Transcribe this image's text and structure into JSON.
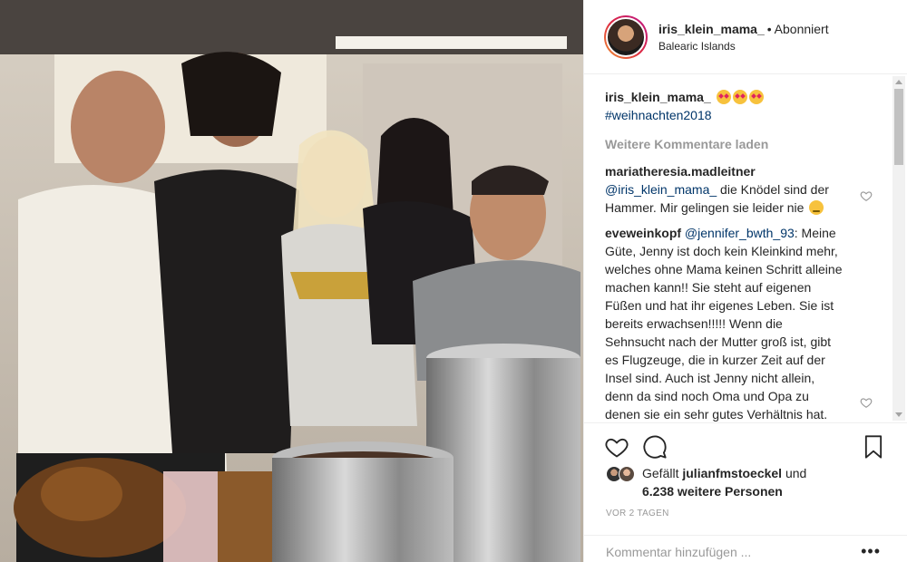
{
  "post": {
    "photo_alt": "Group photo in a kitchen with roasted chicken and cooking pots"
  },
  "header": {
    "username": "iris_klein_mama_",
    "separator": "•",
    "follow_status": "Abonniert",
    "location": "Balearic Islands"
  },
  "caption": {
    "username": "iris_klein_mama_",
    "hashtag": "#weihnachten2018"
  },
  "load_more_label": "Weitere Kommentare laden",
  "comments": [
    {
      "username": "mariatheresia.madleitner",
      "mention": "@iris_klein_mama_",
      "text": " die Knödel sind der Hammer. Mir gelingen sie leider nie "
    },
    {
      "username": "eveweinkopf",
      "mention": "@jennifer_bwth_93",
      "text": ": Meine Güte, Jenny ist doch kein Kleinkind mehr, welches ohne Mama keinen Schritt alleine machen kann!! Sie steht auf eigenen Füßen und hat ihr eigenes Leben. Sie ist bereits erwachsen!!!!! Wenn die Sehnsucht nach der Mutter groß ist, gibt es Flugzeuge, die in kurzer Zeit auf der Insel sind. Auch ist Jenny nicht allein, denn da sind noch Oma und Opa zu denen sie ein sehr gutes Verhältnis hat."
    }
  ],
  "likes": {
    "prefix": "Gefällt ",
    "first_user": "julianfmstoeckel",
    "connector": " und",
    "others": "6.238 weitere Personen"
  },
  "timestamp": "VOR 2 TAGEN",
  "add_comment": {
    "placeholder": "Kommentar hinzufügen ..."
  },
  "more_label": "•••",
  "colors": {
    "link": "#003569",
    "muted": "#999999",
    "text": "#262626"
  },
  "icons": [
    "heart-icon",
    "comment-icon",
    "bookmark-icon",
    "more-options-icon"
  ]
}
